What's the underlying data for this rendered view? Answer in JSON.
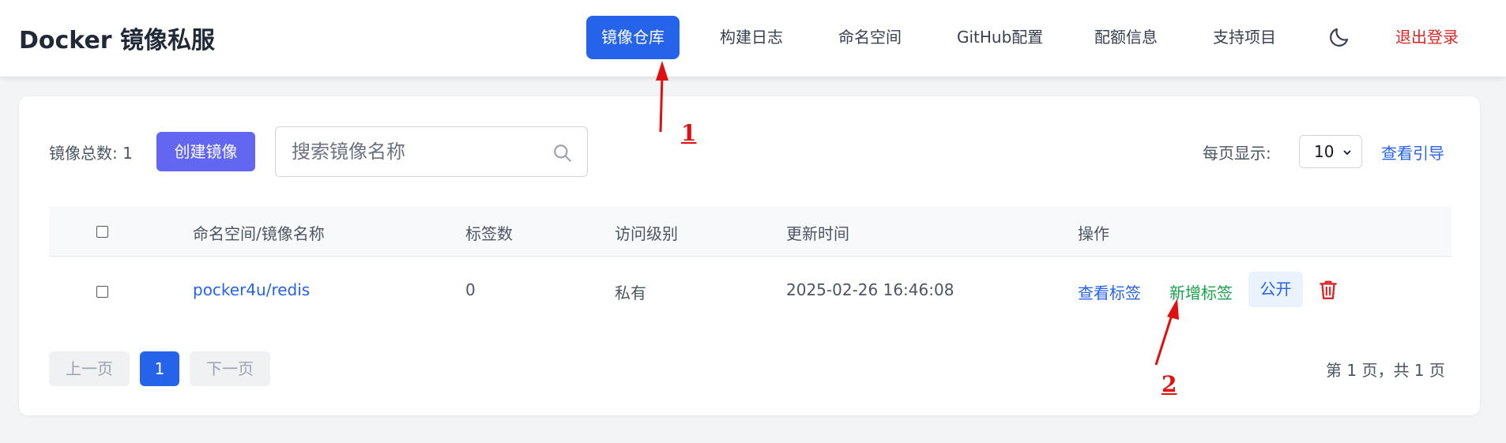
{
  "header": {
    "brand": "Docker 镜像私服",
    "nav": [
      "镜像仓库",
      "构建日志",
      "命名空间",
      "GitHub配置",
      "配额信息",
      "支持项目"
    ],
    "logout": "退出登录"
  },
  "toolbar": {
    "total_label": "镜像总数: 1",
    "create_button": "创建镜像",
    "search_placeholder": "搜索镜像名称",
    "per_page_label": "每页显示:",
    "per_page_value": "10",
    "guide_link": "查看引导"
  },
  "table": {
    "columns": [
      "命名空间/镜像名称",
      "标签数",
      "访问级别",
      "更新时间",
      "操作"
    ],
    "rows": [
      {
        "name": "pocker4u/redis",
        "tags": "0",
        "access": "私有",
        "updated": "2025-02-26 16:46:08",
        "actions": {
          "view_tags": "查看标签",
          "add_tag": "新增标签",
          "make_public": "公开"
        }
      }
    ]
  },
  "pagination": {
    "prev": "上一页",
    "current": "1",
    "next": "下一页",
    "info": "第 1 页，共 1 页"
  },
  "annotations": [
    "1",
    "2"
  ],
  "colors": {
    "primary": "#2563eb",
    "create_button": "#6366f1",
    "logout": "#dc2626",
    "add_tag": "#16a34a",
    "annotation": "#e01010"
  }
}
